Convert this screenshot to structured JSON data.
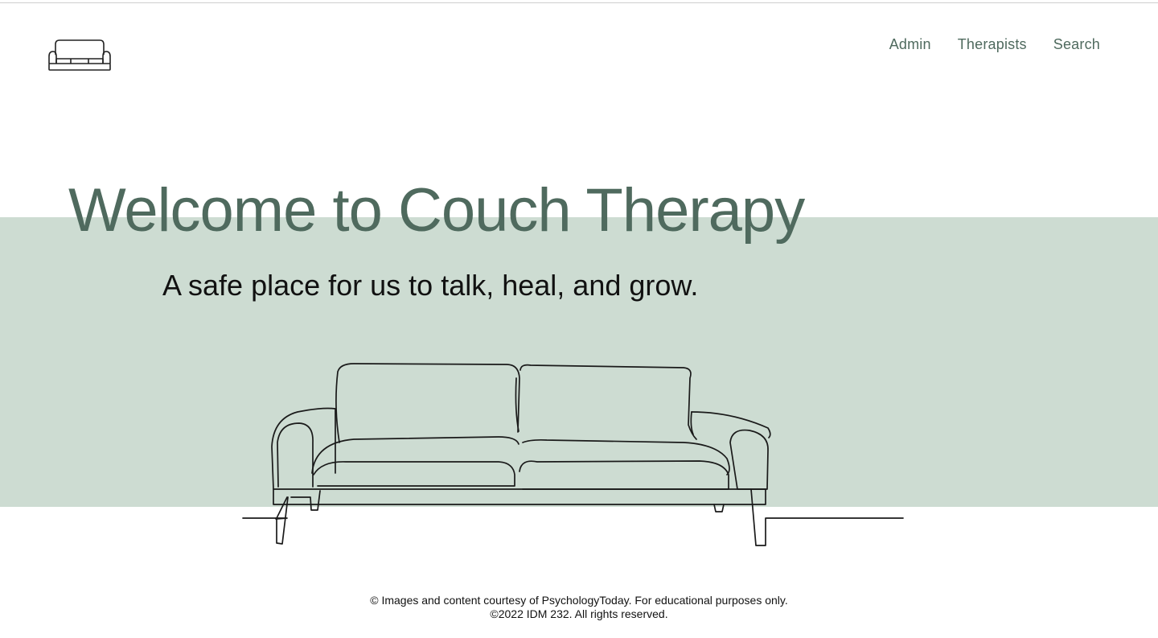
{
  "header": {
    "logo_icon": "couch-icon",
    "nav": [
      {
        "label": "Admin"
      },
      {
        "label": "Therapists"
      },
      {
        "label": "Search"
      }
    ]
  },
  "hero": {
    "title": "Welcome to Couch Therapy",
    "subtitle": "A safe place for us to talk, heal, and grow.",
    "illustration_icon": "couch-line-drawing-icon",
    "band_color": "#cddcd2",
    "accent_color": "#4f6a5e"
  },
  "footer": {
    "line1": "© Images and content courtesy of PsychologyToday. For educational purposes only.",
    "line2": "©2022 IDM 232. All rights reserved."
  }
}
